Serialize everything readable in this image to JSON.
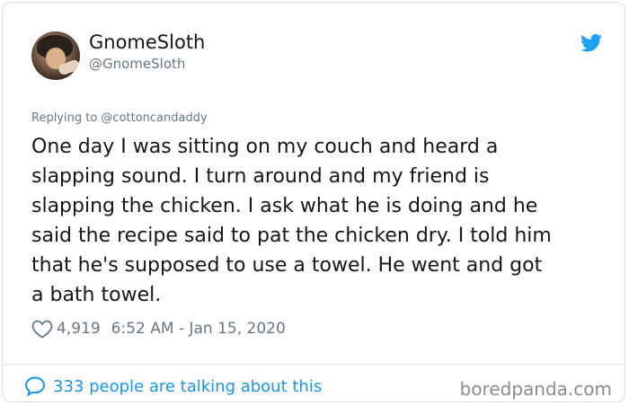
{
  "author": {
    "display_name": "GnomeSloth",
    "handle": "@GnomeSloth"
  },
  "reply_to": "Replying to @cottoncandaddy",
  "tweet_lines": [
    "One day I was sitting on my couch and heard a",
    "slapping sound.  I turn around and my friend is",
    "slapping the chicken. I ask what he is doing and he",
    "said the recipe said to pat the chicken dry. I told him",
    "that he's supposed to use a towel. He went and got",
    "a bath towel."
  ],
  "likes": "4,919",
  "timestamp": "6:52 AM - Jan 15, 2020",
  "talking_text": "333 people are talking about this",
  "watermark": "boredpanda.com",
  "icons": {
    "logo": "twitter-bird-icon",
    "like": "heart-icon",
    "conversation": "speech-bubble-icon"
  },
  "colors": {
    "twitter_blue": "#1da1f2",
    "link_blue": "#1b95e0",
    "muted_gray": "#657786",
    "text": "#14171a"
  }
}
